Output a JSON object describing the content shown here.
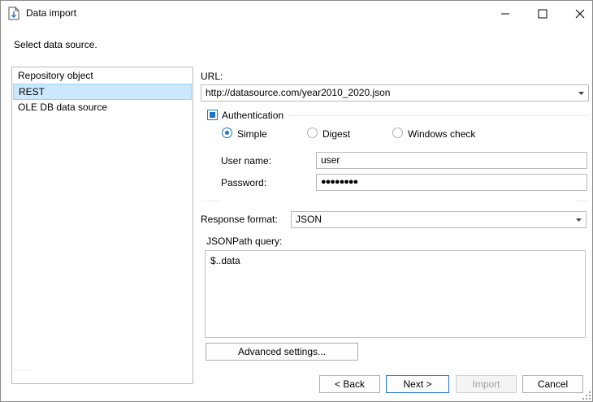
{
  "window": {
    "title": "Data import"
  },
  "instruction": "Select data source.",
  "sources": [
    {
      "label": "Repository object",
      "selected": false
    },
    {
      "label": "REST",
      "selected": true
    },
    {
      "label": "OLE DB data source",
      "selected": false
    }
  ],
  "url": {
    "label": "URL:",
    "value": "http://datasource.com/year2010_2020.json"
  },
  "authentication": {
    "label": "Authentication",
    "checked": true,
    "modes": [
      {
        "label": "Simple",
        "selected": true
      },
      {
        "label": "Digest",
        "selected": false
      },
      {
        "label": "Windows check",
        "selected": false
      }
    ],
    "username_label": "User name:",
    "username_value": "user",
    "password_label": "Password:",
    "password_value": "●●●●●●●●"
  },
  "response_format": {
    "label": "Response format:",
    "value": "JSON"
  },
  "jsonpath": {
    "label": "JSONPath query:",
    "value": "$..data"
  },
  "buttons": {
    "advanced": "Advanced settings...",
    "back": "< Back",
    "next": "Next >",
    "import": "Import",
    "cancel": "Cancel"
  },
  "colors": {
    "accent": "#1e76c9",
    "selection_bg": "#cce8ff",
    "selection_border": "#99d1ff"
  }
}
